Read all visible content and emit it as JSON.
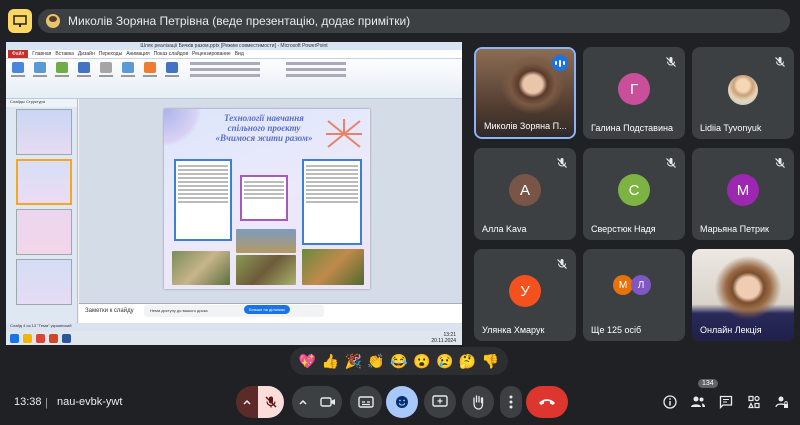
{
  "presenter_bar": {
    "text": "Миколів Зоряна Петрівна (веде презентацію, додає примітки)"
  },
  "shared_screen": {
    "window_title": "Шлях реалізації Бичків разом.pptx [Режим совместимости] - Microsoft PowerPoint",
    "file_tab": "Файл",
    "ribbon_tabs": [
      "Главная",
      "Вставка",
      "Дизайн",
      "Переходы",
      "Анимация",
      "Показ слайдов",
      "Рецензирование",
      "Вид"
    ],
    "pane_tabs": "Слайды    Структура",
    "notes_placeholder": "Заметки к слайду",
    "status_text": "Слайд 4 из 13  \"Тема\"  украинский",
    "clock_time": "13:21",
    "clock_date": "20.11.2024",
    "drive_notice": "Нема доступу до вашого диска",
    "drive_button": "Більше на ділянках",
    "slide": {
      "title_lines": [
        "Технології навчання",
        "спільного проєкту",
        "«Вчимося жити разом»"
      ]
    }
  },
  "participants": [
    {
      "name": "Миколів Зоряна П...",
      "type": "video",
      "speaking": true
    },
    {
      "name": "Галина Подставина",
      "type": "letter",
      "letter": "Г",
      "color": "#c94f9b"
    },
    {
      "name": "Lidiia Tyvonyuk",
      "type": "photo"
    },
    {
      "name": "Алла Kava",
      "type": "letter",
      "letter": "А",
      "color": "#795548"
    },
    {
      "name": "Сверстюк Надя",
      "type": "letter",
      "letter": "С",
      "color": "#7cb342"
    },
    {
      "name": "Марьяна Петрик",
      "type": "letter",
      "letter": "М",
      "color": "#9c27b0"
    },
    {
      "name": "Улянка Хмарук",
      "type": "letter",
      "letter": "У",
      "color": "#f4511e"
    },
    {
      "name": "Ще 125 осіб",
      "type": "more",
      "letters": [
        "М",
        "Л"
      ]
    },
    {
      "name": "Онлайн Лекція",
      "type": "video2"
    }
  ],
  "reactions": [
    "💖",
    "👍",
    "🎉",
    "👏",
    "😂",
    "😮",
    "😢",
    "🤔",
    "👎"
  ],
  "bottom": {
    "time": "13:38",
    "separator": "|",
    "meeting_code": "nau-evbk-ywt",
    "participant_count": "134"
  }
}
